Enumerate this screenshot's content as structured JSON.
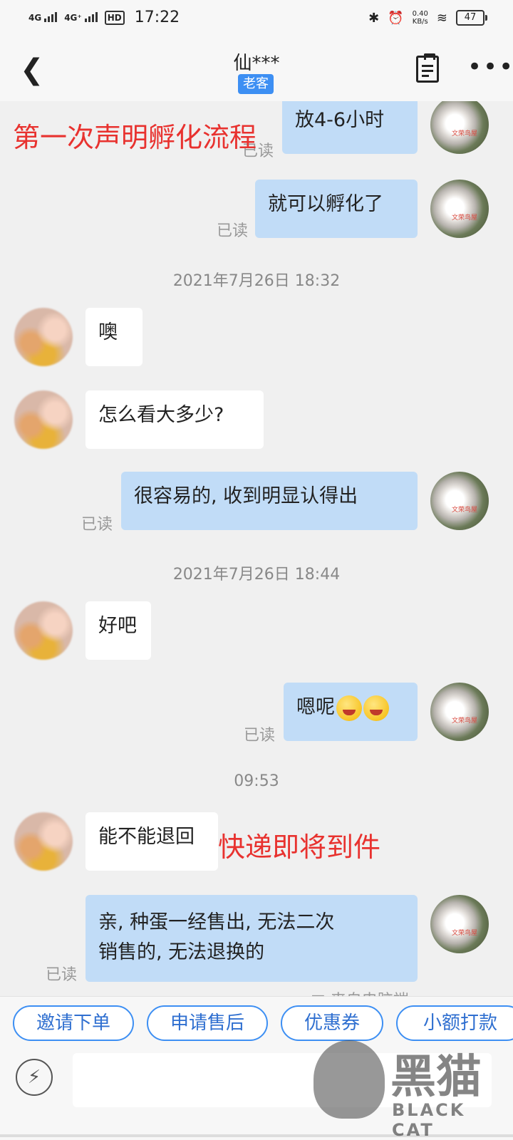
{
  "status_bar": {
    "network_1": "4G",
    "network_2": "4G⁺",
    "hd": "HD",
    "time": "17:22",
    "speed_value": "0.40",
    "speed_unit": "KB/s",
    "battery": "47"
  },
  "header": {
    "title": "仙***",
    "badge": "老客"
  },
  "annotations": {
    "top": "第一次声明孵化流程",
    "middle": "快递即将到件"
  },
  "messages": {
    "m1": "放4-6小时",
    "m2": "就可以孵化了",
    "ts1": "2021年7月26日 18:32",
    "m3": "噢",
    "m4": "怎么看大多少?",
    "m5": "很容易的, 收到明显认得出",
    "ts2": "2021年7月26日 18:44",
    "m6": "好吧",
    "m7": "嗯呢",
    "ts3": "09:53",
    "m8": "能不能退回",
    "m9_line1": "亲, 种蛋一经售出, 无法二次",
    "m9_line2": "销售的, 无法退换的",
    "read_label": "已读",
    "from_pc": "□ 来自电脑端"
  },
  "avatar_me_text": "文荣鸟屋",
  "actions": [
    "邀请下单",
    "申请售后",
    "优惠券",
    "小额打款"
  ],
  "watermark": {
    "cn": "黑猫",
    "en": "BLACK CAT"
  }
}
